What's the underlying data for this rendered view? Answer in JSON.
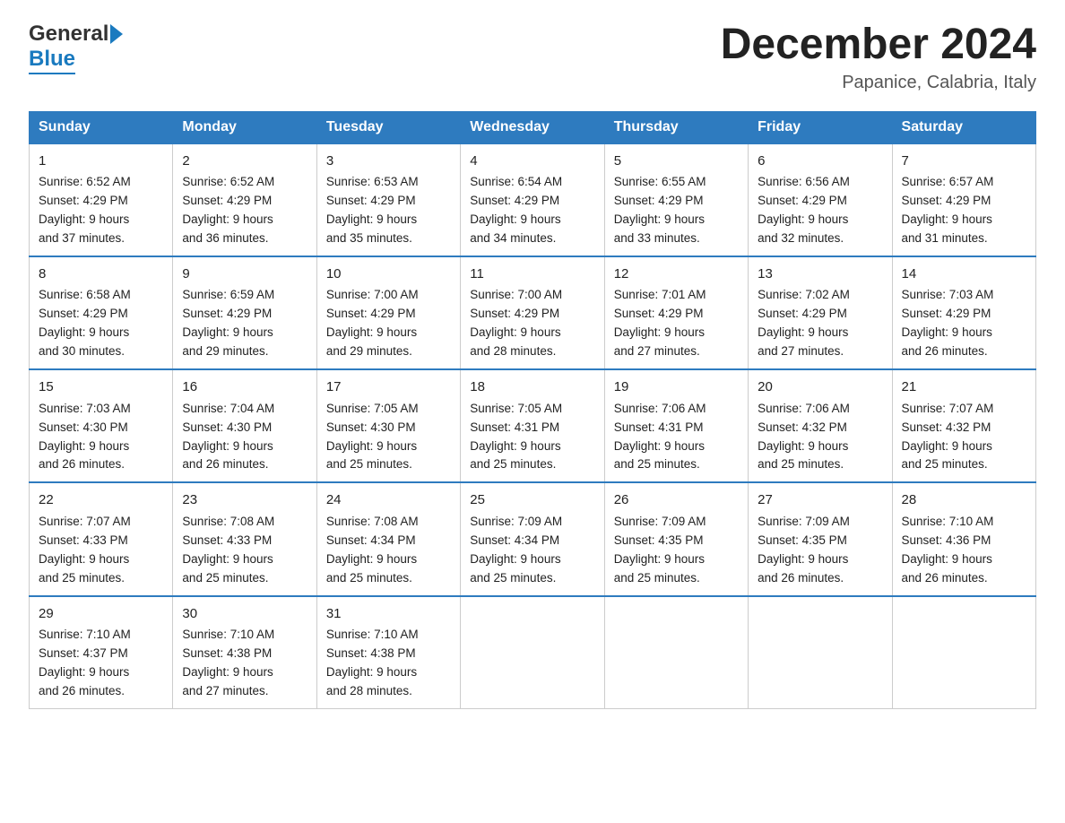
{
  "header": {
    "logo_general": "General",
    "logo_blue": "Blue",
    "title": "December 2024",
    "subtitle": "Papanice, Calabria, Italy"
  },
  "calendar": {
    "days": [
      "Sunday",
      "Monday",
      "Tuesday",
      "Wednesday",
      "Thursday",
      "Friday",
      "Saturday"
    ],
    "weeks": [
      [
        {
          "num": "1",
          "info": "Sunrise: 6:52 AM\nSunset: 4:29 PM\nDaylight: 9 hours\nand 37 minutes."
        },
        {
          "num": "2",
          "info": "Sunrise: 6:52 AM\nSunset: 4:29 PM\nDaylight: 9 hours\nand 36 minutes."
        },
        {
          "num": "3",
          "info": "Sunrise: 6:53 AM\nSunset: 4:29 PM\nDaylight: 9 hours\nand 35 minutes."
        },
        {
          "num": "4",
          "info": "Sunrise: 6:54 AM\nSunset: 4:29 PM\nDaylight: 9 hours\nand 34 minutes."
        },
        {
          "num": "5",
          "info": "Sunrise: 6:55 AM\nSunset: 4:29 PM\nDaylight: 9 hours\nand 33 minutes."
        },
        {
          "num": "6",
          "info": "Sunrise: 6:56 AM\nSunset: 4:29 PM\nDaylight: 9 hours\nand 32 minutes."
        },
        {
          "num": "7",
          "info": "Sunrise: 6:57 AM\nSunset: 4:29 PM\nDaylight: 9 hours\nand 31 minutes."
        }
      ],
      [
        {
          "num": "8",
          "info": "Sunrise: 6:58 AM\nSunset: 4:29 PM\nDaylight: 9 hours\nand 30 minutes."
        },
        {
          "num": "9",
          "info": "Sunrise: 6:59 AM\nSunset: 4:29 PM\nDaylight: 9 hours\nand 29 minutes."
        },
        {
          "num": "10",
          "info": "Sunrise: 7:00 AM\nSunset: 4:29 PM\nDaylight: 9 hours\nand 29 minutes."
        },
        {
          "num": "11",
          "info": "Sunrise: 7:00 AM\nSunset: 4:29 PM\nDaylight: 9 hours\nand 28 minutes."
        },
        {
          "num": "12",
          "info": "Sunrise: 7:01 AM\nSunset: 4:29 PM\nDaylight: 9 hours\nand 27 minutes."
        },
        {
          "num": "13",
          "info": "Sunrise: 7:02 AM\nSunset: 4:29 PM\nDaylight: 9 hours\nand 27 minutes."
        },
        {
          "num": "14",
          "info": "Sunrise: 7:03 AM\nSunset: 4:29 PM\nDaylight: 9 hours\nand 26 minutes."
        }
      ],
      [
        {
          "num": "15",
          "info": "Sunrise: 7:03 AM\nSunset: 4:30 PM\nDaylight: 9 hours\nand 26 minutes."
        },
        {
          "num": "16",
          "info": "Sunrise: 7:04 AM\nSunset: 4:30 PM\nDaylight: 9 hours\nand 26 minutes."
        },
        {
          "num": "17",
          "info": "Sunrise: 7:05 AM\nSunset: 4:30 PM\nDaylight: 9 hours\nand 25 minutes."
        },
        {
          "num": "18",
          "info": "Sunrise: 7:05 AM\nSunset: 4:31 PM\nDaylight: 9 hours\nand 25 minutes."
        },
        {
          "num": "19",
          "info": "Sunrise: 7:06 AM\nSunset: 4:31 PM\nDaylight: 9 hours\nand 25 minutes."
        },
        {
          "num": "20",
          "info": "Sunrise: 7:06 AM\nSunset: 4:32 PM\nDaylight: 9 hours\nand 25 minutes."
        },
        {
          "num": "21",
          "info": "Sunrise: 7:07 AM\nSunset: 4:32 PM\nDaylight: 9 hours\nand 25 minutes."
        }
      ],
      [
        {
          "num": "22",
          "info": "Sunrise: 7:07 AM\nSunset: 4:33 PM\nDaylight: 9 hours\nand 25 minutes."
        },
        {
          "num": "23",
          "info": "Sunrise: 7:08 AM\nSunset: 4:33 PM\nDaylight: 9 hours\nand 25 minutes."
        },
        {
          "num": "24",
          "info": "Sunrise: 7:08 AM\nSunset: 4:34 PM\nDaylight: 9 hours\nand 25 minutes."
        },
        {
          "num": "25",
          "info": "Sunrise: 7:09 AM\nSunset: 4:34 PM\nDaylight: 9 hours\nand 25 minutes."
        },
        {
          "num": "26",
          "info": "Sunrise: 7:09 AM\nSunset: 4:35 PM\nDaylight: 9 hours\nand 25 minutes."
        },
        {
          "num": "27",
          "info": "Sunrise: 7:09 AM\nSunset: 4:35 PM\nDaylight: 9 hours\nand 26 minutes."
        },
        {
          "num": "28",
          "info": "Sunrise: 7:10 AM\nSunset: 4:36 PM\nDaylight: 9 hours\nand 26 minutes."
        }
      ],
      [
        {
          "num": "29",
          "info": "Sunrise: 7:10 AM\nSunset: 4:37 PM\nDaylight: 9 hours\nand 26 minutes."
        },
        {
          "num": "30",
          "info": "Sunrise: 7:10 AM\nSunset: 4:38 PM\nDaylight: 9 hours\nand 27 minutes."
        },
        {
          "num": "31",
          "info": "Sunrise: 7:10 AM\nSunset: 4:38 PM\nDaylight: 9 hours\nand 28 minutes."
        },
        {
          "num": "",
          "info": ""
        },
        {
          "num": "",
          "info": ""
        },
        {
          "num": "",
          "info": ""
        },
        {
          "num": "",
          "info": ""
        }
      ]
    ]
  }
}
